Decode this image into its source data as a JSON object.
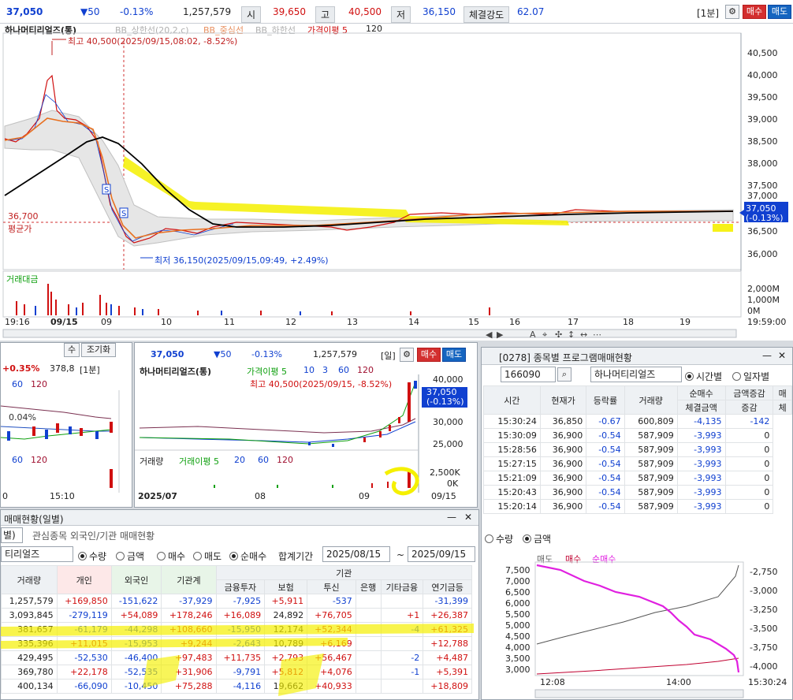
{
  "quote_bar": {
    "price": "37,050",
    "change": "▼50",
    "rate": "-0.13%",
    "volume": "1,257,579",
    "open_label": "시",
    "open": "39,650",
    "high_label": "고",
    "high": "40,500",
    "low_label": "저",
    "low": "36,150",
    "strength_label": "체결강도",
    "strength": "62.07",
    "interval": "[1분]",
    "buy": "매수",
    "sell": "매도"
  },
  "main_chart": {
    "title": "하나머티리얼즈(통)",
    "legend": [
      "BB_상한선(20,2,c)",
      "BB_중심선",
      "BB_하한선",
      "가격이평 5",
      "120"
    ],
    "high_note": "최고 40,500(2025/09/15,08:02, -8.52%)",
    "low_note": "최저 36,150(2025/09/15,09:49, +2.49%)",
    "avg_price": "36,700",
    "avg_label": "평균가",
    "current_box": [
      "37,050",
      "(-0.13%)"
    ],
    "y_ticks": [
      "40,500",
      "40,000",
      "39,500",
      "39,000",
      "38,500",
      "38,000",
      "37,500",
      "37,000",
      "36,500",
      "36,000"
    ],
    "volume_label": "거래대금",
    "vol_ticks": [
      "2,000M",
      "1,000M",
      "0M"
    ],
    "x_ticks": [
      "19:16",
      "09/15",
      "09",
      "10",
      "11",
      "12",
      "13",
      "14",
      "15",
      "16",
      "17",
      "18",
      "19",
      "19:59:00"
    ],
    "marker": "S",
    "toolbar_icons": [
      "◀",
      "▶",
      "A",
      "⌖",
      "✣",
      "↕",
      "↔",
      "⋯"
    ]
  },
  "mini_left": {
    "rate": "+0.35%",
    "price": "378,8",
    "interval": "[1분]",
    "legend1": [
      "60",
      "120"
    ],
    "legend2": [
      "60",
      "120"
    ],
    "top_tabs": [
      "수",
      "조기화"
    ],
    "small_label": "0.04%",
    "x_ticks": [
      "0",
      "15:10"
    ]
  },
  "daily_chart": {
    "price": "37,050",
    "change": "▼50",
    "rate": "-0.13%",
    "volume": "1,257,579",
    "interval": "[일]",
    "buy": "매수",
    "sell": "매도",
    "title": "하나머티리얼즈(통)",
    "legend": [
      "가격이평 5",
      "10",
      "3",
      "60",
      "120"
    ],
    "high_note": "최고 40,500(2025/09/15, -8.52%)",
    "current_box": [
      "37,050",
      "(-0.13%)"
    ],
    "y_ticks": [
      "40,000",
      "30,000",
      "25,000"
    ],
    "vol_legend": [
      "거래량",
      "거래이평 5",
      "20",
      "60",
      "120"
    ],
    "vol_ticks": [
      "2,500K",
      "0K"
    ],
    "x_ticks": [
      "2025/07",
      "08",
      "09",
      "09/15"
    ]
  },
  "program_panel": {
    "title": "[0278] 종목별 프로그램매매현황",
    "code": "166090",
    "name": "하나머티리얼즈",
    "options": [
      "시간별",
      "일자별"
    ],
    "headers": [
      "시간",
      "현재가",
      "등락률",
      "거래량",
      "순매수",
      "금액증감",
      "매"
    ],
    "subheaders": [
      "체결금액",
      "증감",
      "체"
    ],
    "rows": [
      [
        "15:30:24",
        "36,850",
        "-0.67",
        "600,809",
        "-4,135",
        "-142"
      ],
      [
        "15:30:09",
        "36,900",
        "-0.54",
        "587,909",
        "-3,993",
        "0"
      ],
      [
        "15:28:56",
        "36,900",
        "-0.54",
        "587,909",
        "-3,993",
        "0"
      ],
      [
        "15:27:15",
        "36,900",
        "-0.54",
        "587,909",
        "-3,993",
        "0"
      ],
      [
        "15:21:09",
        "36,900",
        "-0.54",
        "587,909",
        "-3,993",
        "0"
      ],
      [
        "15:20:43",
        "36,900",
        "-0.54",
        "587,909",
        "-3,993",
        "0"
      ],
      [
        "15:20:14",
        "36,900",
        "-0.54",
        "587,909",
        "-3,993",
        "0"
      ]
    ],
    "chart_opts": [
      "수량",
      "금액"
    ],
    "chart_legend": [
      "매도",
      "매수",
      "순매수"
    ],
    "left_ticks": [
      "7,500",
      "7,000",
      "6,500",
      "6,000",
      "5,500",
      "5,000",
      "4,500",
      "4,000",
      "3,500",
      "3,000"
    ],
    "right_ticks": [
      "-2,750",
      "-3,000",
      "-3,250",
      "-3,500",
      "-3,750",
      "-4,000"
    ],
    "x_ticks": [
      "12:08",
      "14:00",
      "15:30:24"
    ]
  },
  "investor_panel": {
    "title": "매매현황(일별)",
    "tabs": [
      "별)",
      "관심종목 외국인/기관 매매현황"
    ],
    "stock": "티리얼즈",
    "modes": [
      "수량",
      "금액"
    ],
    "sides": [
      "매수",
      "매도",
      "순매수"
    ],
    "period_label": "합계기간",
    "from": "2025/08/15",
    "to": "2025/09/15",
    "group_header": "기관",
    "headers": [
      "거래량",
      "개인",
      "외국인",
      "기관계",
      "금융투자",
      "보험",
      "투신",
      "은행",
      "기타금융",
      "연기금등"
    ],
    "rows": [
      [
        "1,257,579",
        "+169,850",
        "-151,622",
        "-37,929",
        "-7,925",
        "+5,911",
        "-537",
        "",
        "",
        "-31,399"
      ],
      [
        "3,093,845",
        "-279,119",
        "+54,089",
        "+178,246",
        "+16,089",
        "24,892",
        "+76,705",
        "",
        "+1",
        "+26,387"
      ],
      [
        "381,657",
        "-61,179",
        "-44,298",
        "+108,660",
        "-15,950",
        "12,174",
        "+52,344",
        "",
        "-4",
        "+61,325"
      ],
      [
        "335,396",
        "+11,015",
        "-15,953",
        "+9,244",
        "-2,643",
        "10,789",
        "+6,169",
        "",
        "",
        "+12,788"
      ],
      [
        "429,495",
        "-52,530",
        "-46,400",
        "+97,483",
        "+11,735",
        "+2,793",
        "+56,467",
        "",
        "-2",
        "+4,487"
      ],
      [
        "369,780",
        "+22,178",
        "-52,535",
        "+31,906",
        "-9,791",
        "+5,812",
        "+4,076",
        "",
        "-1",
        "+5,391"
      ],
      [
        "400,134",
        "-66,090",
        "-10,450",
        "+75,288",
        "-4,116",
        "19,662",
        "+40,933",
        "",
        "",
        "+18,809"
      ]
    ]
  },
  "colors": {
    "up": "#d01010",
    "down": "#1040d0",
    "highlight": "#f5f000",
    "ma120": "#000000",
    "ma5": "#e87020"
  }
}
